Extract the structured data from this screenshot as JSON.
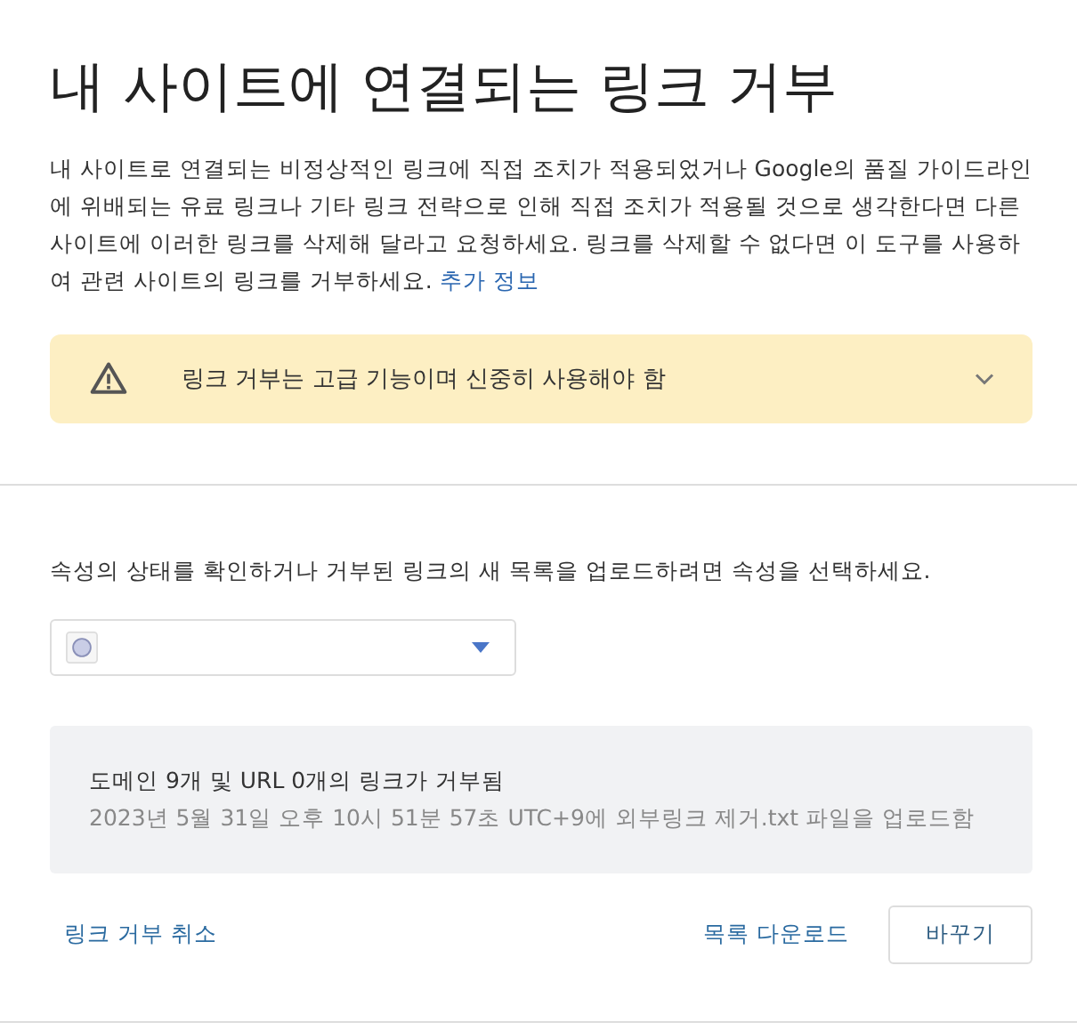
{
  "title": "내 사이트에 연결되는 링크 거부",
  "description": "내 사이트로 연결되는 비정상적인 링크에 직접 조치가 적용되었거나 Google의 품질 가이드라인에 위배되는 유료 링크나 기타 링크 전략으로 인해 직접 조치가 적용될 것으로 생각한다면 다른 사이트에 이러한 링크를 삭제해 달라고 요청하세요. 링크를 삭제할 수 없다면 이 도구를 사용하여 관련 사이트의 링크를 거부하세요.",
  "more_info_link": "추가 정보",
  "warning": {
    "text": "링크 거부는 고급 기능이며 신중히 사용해야 함",
    "expanded": false
  },
  "property_prompt": "속성의 상태를 확인하거나 거부된 링크의 새 목록을 업로드하려면 속성을 선택하세요.",
  "summary": {
    "headline": "도메인 9개 및 URL 0개의 링크가 거부됨",
    "detail": "2023년 5월 31일 오후 10시 51분 57초 UTC+9에 외부링크 제거.txt 파일을 업로드함"
  },
  "actions": {
    "cancel_link": "링크 거부 취소",
    "download_link": "목록 다운로드",
    "replace_button": "바꾸기"
  }
}
